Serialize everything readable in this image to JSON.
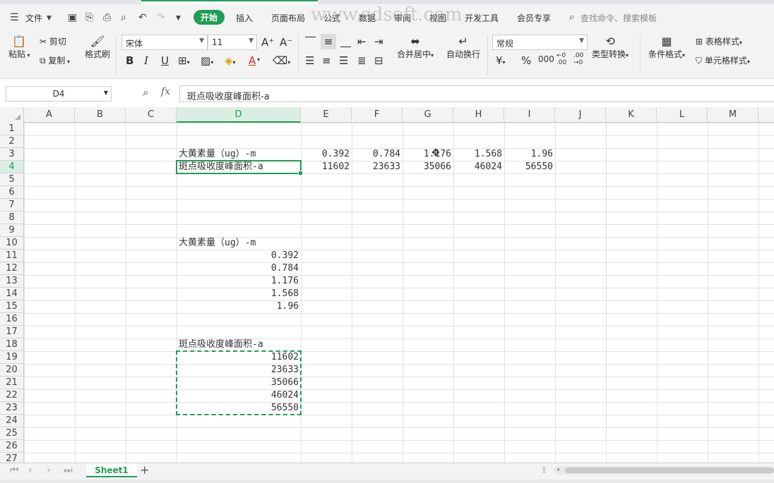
{
  "menu": {
    "file": "文件",
    "tabs": [
      "开始",
      "插入",
      "页面布局",
      "公式",
      "数据",
      "审阅",
      "视图",
      "开发工具",
      "会员专享"
    ],
    "search": "查找命令、搜索模板",
    "watermark": "www.zdsoft.com"
  },
  "ribbon": {
    "paste": "粘贴",
    "cut": "剪切",
    "copy": "复制",
    "format_painter": "格式刷",
    "font_name": "宋体",
    "font_size": "11",
    "merge_center": "合并居中",
    "wrap_text": "自动换行",
    "number_format": "常规",
    "type_convert": "类型转换",
    "cond_format": "条件格式",
    "table_style": "表格样式",
    "cell_style": "单元格样式",
    "bold": "B",
    "italic": "I",
    "underline": "U",
    "font_color": "A"
  },
  "formula_bar": {
    "name_box": "D4",
    "fx": "fx",
    "content": "斑点吸收度峰面积-a"
  },
  "columns": [
    "A",
    "B",
    "C",
    "D",
    "E",
    "F",
    "G",
    "H",
    "I",
    "J",
    "K",
    "L",
    "M"
  ],
  "selected_column": "D",
  "rows": [
    "1",
    "2",
    "3",
    "4",
    "5",
    "6",
    "7",
    "8",
    "9",
    "10",
    "11",
    "12",
    "13",
    "14",
    "15",
    "16",
    "17",
    "18",
    "19",
    "20",
    "21",
    "22",
    "23",
    "24",
    "25",
    "26",
    "27"
  ],
  "selected_row": "4",
  "cells": {
    "D3": "大黄素量（ug）-m",
    "E3": "0.392",
    "F3": "0.784",
    "G3": "1.176",
    "H3": "1.568",
    "I3": "1.96",
    "D4": "斑点吸收度峰面积-a",
    "E4": "11602",
    "F4": "23633",
    "G4": "35066",
    "H4": "46024",
    "I4": "56550",
    "D10": "大黄素量（ug）-m",
    "D11": "0.392",
    "D12": "0.784",
    "D13": "1.176",
    "D14": "1.568",
    "D15": "1.96",
    "D18": "斑点吸收度峰面积-a",
    "D19": "11602",
    "D20": "23633",
    "D21": "35066",
    "D22": "46024",
    "D23": "56550"
  },
  "sheet_tab": "Sheet1",
  "colors": {
    "accent": "#1f9e55"
  }
}
